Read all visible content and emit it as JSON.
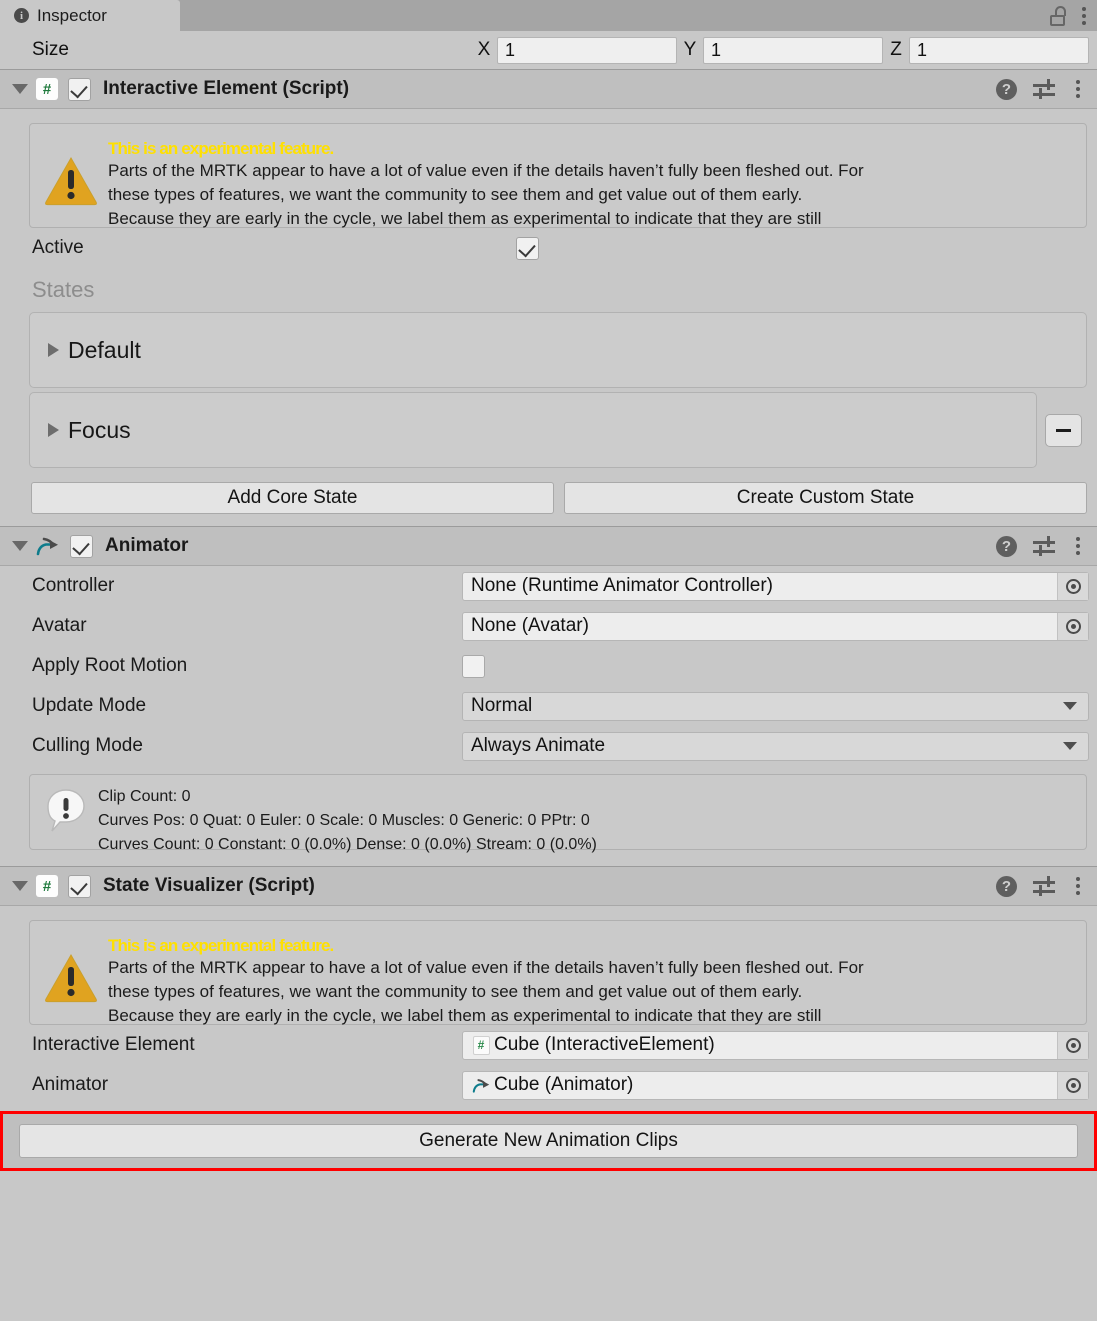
{
  "window": {
    "tab_label": "Inspector",
    "tab_icon": "info-icon",
    "lock_icon": "unlocked-padlock-icon",
    "menu_icon": "kebab-menu-icon"
  },
  "size_row": {
    "label": "Size",
    "axes": [
      {
        "axis": "X",
        "value": "1"
      },
      {
        "axis": "Y",
        "value": "1"
      },
      {
        "axis": "Z",
        "value": "1"
      }
    ]
  },
  "experimental_warning": {
    "title": "This is an experimental feature.",
    "line1": "Parts of the MRTK appear to have a lot of value even if the details haven’t fully been fleshed out. For",
    "line2": "these types of features, we want the community to see them and get value out of them early.",
    "line3": "Because they are early in the cycle, we label them as experimental to indicate that they are still",
    "icon": "warning-triangle-icon",
    "title_color": "#ffe000"
  },
  "components": [
    {
      "title": "Interactive Element (Script)",
      "icon": "script-icon",
      "enabled": true,
      "help_icon": "help-icon",
      "preset_icon": "preset-settings-icon",
      "menu_icon": "kebab-menu-icon"
    },
    {
      "title": "Animator",
      "icon": "animator-icon",
      "enabled": true,
      "help_icon": "help-icon",
      "preset_icon": "preset-settings-icon",
      "menu_icon": "kebab-menu-icon"
    },
    {
      "title": "State Visualizer (Script)",
      "icon": "script-icon",
      "enabled": true,
      "help_icon": "help-icon",
      "preset_icon": "preset-settings-icon",
      "menu_icon": "kebab-menu-icon"
    }
  ],
  "interactive_element": {
    "active_label": "Active",
    "active_checked": true,
    "states_label": "States",
    "states": [
      {
        "name": "Default",
        "removable": false
      },
      {
        "name": "Focus",
        "removable": true,
        "remove_label": "−"
      }
    ],
    "add_core_state_label": "Add Core State",
    "create_custom_state_label": "Create Custom State"
  },
  "animator": {
    "rows": [
      {
        "label": "Controller",
        "value": "None (Runtime Animator Controller)",
        "type": "object"
      },
      {
        "label": "Avatar",
        "value": "None (Avatar)",
        "type": "object"
      },
      {
        "label": "Apply Root Motion",
        "value": "",
        "type": "checkbox",
        "checked": false
      },
      {
        "label": "Update Mode",
        "value": "Normal",
        "type": "dropdown"
      },
      {
        "label": "Culling Mode",
        "value": "Always Animate",
        "type": "dropdown"
      }
    ],
    "info": {
      "icon": "info-bubble-icon",
      "line1": "Clip Count: 0",
      "line2": "Curves Pos: 0 Quat: 0 Euler: 0 Scale: 0 Muscles: 0 Generic: 0 PPtr: 0",
      "line3": "Curves Count: 0 Constant: 0 (0.0%) Dense: 0 (0.0%) Stream: 0 (0.0%)"
    }
  },
  "state_visualizer": {
    "rows": [
      {
        "label": "Interactive Element",
        "value": "Cube (InteractiveElement)",
        "icon": "script-icon"
      },
      {
        "label": "Animator",
        "value": "Cube (Animator)",
        "icon": "animator-icon"
      }
    ],
    "generate_button_label": "Generate New Animation Clips",
    "highlight_color": "#ff0000"
  }
}
